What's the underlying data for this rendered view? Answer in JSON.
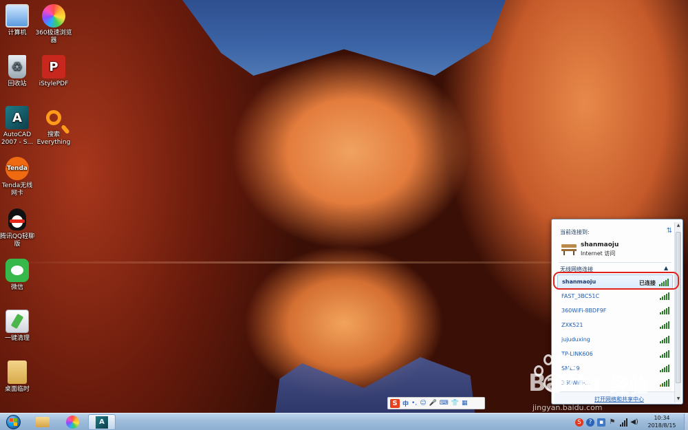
{
  "desktop": {
    "icons": [
      {
        "label_line1": "计算机",
        "label_line2": "",
        "icon": "computer-icon"
      },
      {
        "label_line1": "360极速浏览",
        "label_line2": "器",
        "icon": "360-browser-icon"
      },
      {
        "label_line1": "回收站",
        "label_line2": "",
        "icon": "recycle-bin-icon"
      },
      {
        "label_line1": "iStylePDF",
        "label_line2": "",
        "icon": "pdf-icon"
      },
      {
        "label_line1": "AutoCAD",
        "label_line2": "2007 - S...",
        "icon": "autocad-icon"
      },
      {
        "label_line1": "搜索",
        "label_line2": "Everything",
        "icon": "search-everything-icon"
      },
      {
        "label_line1": "Tenda无线",
        "label_line2": "网卡",
        "icon": "tenda-wifi-icon"
      },
      {
        "label_line1": "腾讯QQ轻聊",
        "label_line2": "版",
        "icon": "qq-icon"
      },
      {
        "label_line1": "微信",
        "label_line2": "",
        "icon": "wechat-icon"
      },
      {
        "label_line1": "一键清理",
        "label_line2": "",
        "icon": "cleanup-icon"
      },
      {
        "label_line1": "桌面临时",
        "label_line2": "",
        "icon": "folder-icon"
      }
    ],
    "icon_glyphs": {
      "pdf": "P",
      "autocad": "A",
      "tenda": "Tenda"
    }
  },
  "network_flyout": {
    "header": "当前连接到:",
    "current": {
      "name": "shanmaoju",
      "status": "Internet 访问"
    },
    "section_label": "无线网络连接",
    "connected_tag": "已连接",
    "networks": [
      {
        "ssid": "shanmaoju",
        "connected": true
      },
      {
        "ssid": "FAST_3BC51C",
        "connected": false
      },
      {
        "ssid": "360WiFi-8BDF9F",
        "connected": false
      },
      {
        "ssid": "ZXK521",
        "connected": false
      },
      {
        "ssid": "jujuduxing",
        "connected": false
      },
      {
        "ssid": "TP-LINK606",
        "connected": false
      },
      {
        "ssid": "SML19",
        "connected": false
      },
      {
        "ssid": "360WiFi-...",
        "connected": false
      }
    ],
    "footer_link": "打开网络和共享中心"
  },
  "ime": {
    "logo": "S",
    "lang": "中",
    "symbols": [
      "•,",
      "☺",
      "🎤",
      "⌨",
      "👕",
      "▦"
    ]
  },
  "taskbar": {
    "clock_time": "10:34",
    "clock_date": "2018/8/15",
    "apps": [
      "file-explorer",
      "360-browser",
      "autocad"
    ]
  },
  "watermark": {
    "brand": "Baidu",
    "brand_cn": "经验",
    "url": "jingyan.baidu.com"
  },
  "colors": {
    "highlight_ring": "#e0201b",
    "signal_green": "#3fa83c",
    "link_blue": "#1d5ab0"
  }
}
